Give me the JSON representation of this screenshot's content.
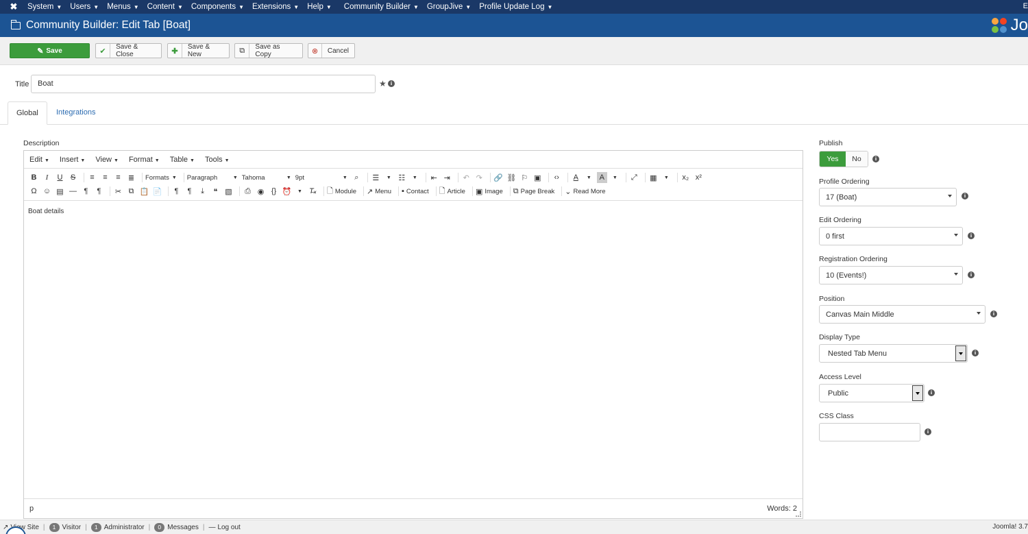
{
  "topnav": {
    "items": [
      "System",
      "Users",
      "Menus",
      "Content",
      "Components",
      "Extensions",
      "Help",
      "Community Builder",
      "GroupJive",
      "Profile Update Log"
    ],
    "right_edge": "E"
  },
  "header": {
    "title": "Community Builder: Edit Tab [Boat]",
    "brand": "Jo"
  },
  "toolbar": {
    "save": "Save",
    "save_close": "Save & Close",
    "save_new": "Save & New",
    "save_copy": "Save as Copy",
    "cancel": "Cancel"
  },
  "form": {
    "title_label": "Title",
    "title_value": "Boat"
  },
  "tabs": {
    "global": "Global",
    "integrations": "Integrations"
  },
  "editor": {
    "label": "Description",
    "menus": [
      "Edit",
      "Insert",
      "View",
      "Format",
      "Table",
      "Tools"
    ],
    "formats": "Formats",
    "block": "Paragraph",
    "font": "Tahoma",
    "size": "9pt",
    "buttons": {
      "module": "Module",
      "menu": "Menu",
      "contact": "Contact",
      "article": "Article",
      "image": "Image",
      "page_break": "Page Break",
      "read_more": "Read More"
    },
    "content": "Boat details",
    "path": "p",
    "words": "Words: 2"
  },
  "side": {
    "publish_label": "Publish",
    "publish_yes": "Yes",
    "publish_no": "No",
    "profile_ordering_label": "Profile Ordering",
    "profile_ordering_value": "17 (Boat)",
    "edit_ordering_label": "Edit Ordering",
    "edit_ordering_value": "0 first",
    "registration_ordering_label": "Registration Ordering",
    "registration_ordering_value": "10 (Events!)",
    "position_label": "Position",
    "position_value": "Canvas Main Middle",
    "display_type_label": "Display Type",
    "display_type_value": "Nested Tab Menu",
    "access_level_label": "Access Level",
    "access_level_value": "Public",
    "css_class_label": "CSS Class",
    "css_class_value": ""
  },
  "footer": {
    "view_site": "View Site",
    "visitor_count": "1",
    "visitor": "Visitor",
    "admin_count": "1",
    "administrator": "Administrator",
    "messages_count": "0",
    "messages": "Messages",
    "logout": "Log out",
    "version": "Joomla! 3.7"
  },
  "colors": {
    "nav_bg": "#1a3867",
    "header_bg": "#1c5494",
    "save_green": "#3c9c3c",
    "link_blue": "#2a6ab0"
  }
}
